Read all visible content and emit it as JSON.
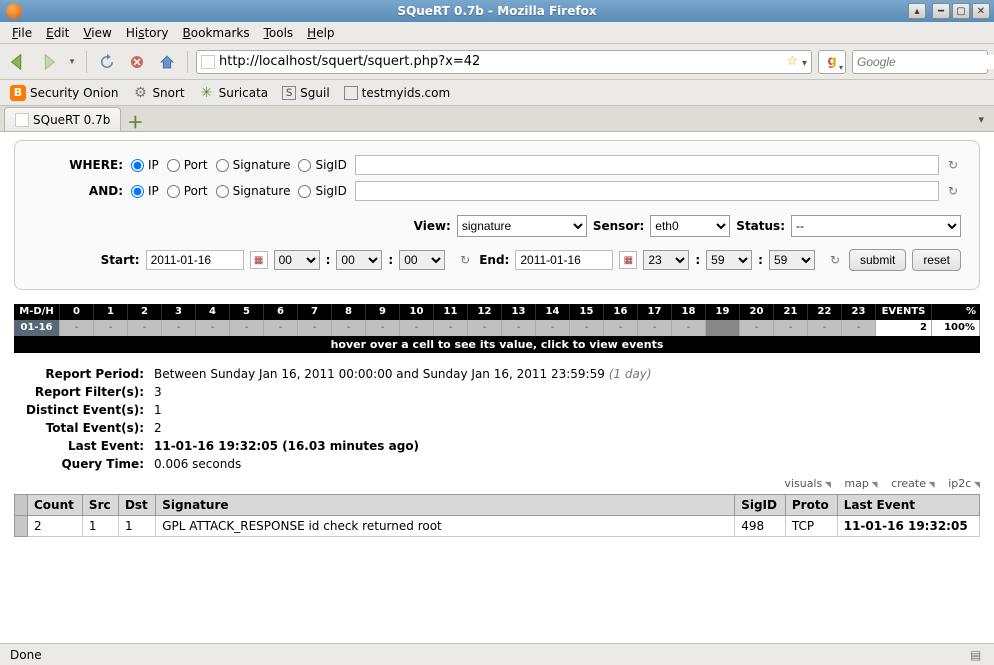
{
  "window": {
    "title": "SQueRT 0.7b - Mozilla Firefox"
  },
  "menu": {
    "file": "File",
    "edit": "Edit",
    "view": "View",
    "history": "History",
    "bookmarks": "Bookmarks",
    "tools": "Tools",
    "help": "Help"
  },
  "nav": {
    "url": "http://localhost/squert/squert.php?x=42",
    "search_placeholder": "Google"
  },
  "bookmarks": [
    {
      "label": "Security Onion",
      "icon": "orange-b"
    },
    {
      "label": "Snort",
      "icon": "gear"
    },
    {
      "label": "Suricata",
      "icon": "burst"
    },
    {
      "label": "Sguil",
      "icon": "box-s"
    },
    {
      "label": "testmyids.com",
      "icon": "box-blank"
    }
  ],
  "tabs": {
    "active": "SQueRT 0.7b"
  },
  "filters": {
    "where_label": "WHERE:",
    "and_label": "AND:",
    "radios": {
      "ip": "IP",
      "port": "Port",
      "signature": "Signature",
      "sigid": "SigID"
    },
    "where_selected": "ip",
    "and_selected": "ip",
    "where_value": "",
    "and_value": ""
  },
  "view": {
    "label": "View:",
    "value": "signature"
  },
  "sensor": {
    "label": "Sensor:",
    "value": "eth0"
  },
  "status": {
    "label": "Status:",
    "value": "--"
  },
  "dates": {
    "start_label": "Start:",
    "start": "2011-01-16",
    "end_label": "End:",
    "end": "2011-01-16",
    "start_h": "00",
    "start_m": "00",
    "start_s": "00",
    "end_h": "23",
    "end_m": "59",
    "end_s": "59"
  },
  "buttons": {
    "submit": "submit",
    "reset": "reset"
  },
  "timeline": {
    "mdh_label": "M-D/H",
    "hours": [
      "0",
      "1",
      "2",
      "3",
      "4",
      "5",
      "6",
      "7",
      "8",
      "9",
      "10",
      "11",
      "12",
      "13",
      "14",
      "15",
      "16",
      "17",
      "18",
      "19",
      "20",
      "21",
      "22",
      "23"
    ],
    "events_label": "EVENTS",
    "pct_label": "%",
    "date_label": "01-16",
    "cells": [
      "-",
      "-",
      "-",
      "-",
      "-",
      "-",
      "-",
      "-",
      "-",
      "-",
      "-",
      "-",
      "-",
      "-",
      "-",
      "-",
      "-",
      "-",
      "-",
      "",
      "-",
      "-",
      "-",
      "-"
    ],
    "highlight_index": 19,
    "events": "2",
    "pct": "100%",
    "hover_hint": "hover over a cell to see its value, click to view events"
  },
  "report": {
    "period_label": "Report Period:",
    "period_val": "Between Sunday Jan 16, 2011 00:00:00 and Sunday Jan 16, 2011 23:59:59",
    "period_muted": "(1 day)",
    "filters_label": "Report Filter(s):",
    "filters_val": "3",
    "distinct_label": "Distinct Event(s):",
    "distinct_val": "1",
    "total_label": "Total Event(s):",
    "total_val": "2",
    "last_label": "Last Event:",
    "last_val": "11-01-16 19:32:05 (16.03 minutes ago)",
    "qtime_label": "Query Time:",
    "qtime_val": "0.006 seconds"
  },
  "actions": {
    "visuals": "visuals",
    "map": "map",
    "create": "create",
    "ip2c": "ip2c"
  },
  "table": {
    "headers": {
      "count": "Count",
      "src": "Src",
      "dst": "Dst",
      "signature": "Signature",
      "sigid": "SigID",
      "proto": "Proto",
      "last": "Last Event"
    },
    "rows": [
      {
        "count": "2",
        "src": "1",
        "dst": "1",
        "signature": "GPL ATTACK_RESPONSE id check returned root",
        "sigid": "498",
        "proto": "TCP",
        "last": "11-01-16 19:32:05"
      }
    ]
  },
  "statusbar": {
    "text": "Done"
  }
}
